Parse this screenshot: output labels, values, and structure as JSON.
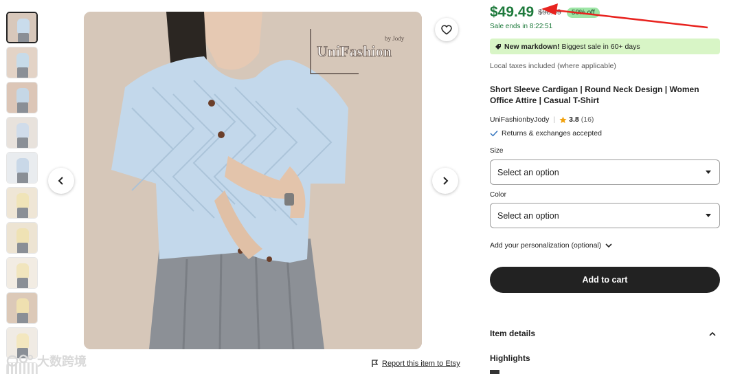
{
  "thumbnails": [
    {
      "bg": "#d8c8bb",
      "top": "#c9dcec",
      "active": true
    },
    {
      "bg": "#e3d3c6",
      "top": "#c7dbe9",
      "active": false
    },
    {
      "bg": "#dcc6b7",
      "top": "#c5d7e6",
      "active": false
    },
    {
      "bg": "#e8e2dc",
      "top": "#d0dcea",
      "active": false
    },
    {
      "bg": "#e9ecef",
      "top": "#c9d8e8",
      "active": false
    },
    {
      "bg": "#efe6d6",
      "top": "#f0e4b8",
      "active": false
    },
    {
      "bg": "#ede4d3",
      "top": "#efe2b4",
      "active": false
    },
    {
      "bg": "#f2ece3",
      "top": "#f1e5bd",
      "active": false
    },
    {
      "bg": "#dcc9b8",
      "top": "#efe0b0",
      "active": false
    },
    {
      "bg": "#f0ebe4",
      "top": "#f3e7bf",
      "active": false
    }
  ],
  "image": {
    "brand_main": "UniFashion",
    "brand_small": "by Jody"
  },
  "report_link": "Report this item to Etsy",
  "watermark_text": "大数跨境",
  "price": {
    "current": "$49.49",
    "original": "$98.99",
    "discount": "50% off",
    "sale_ends": "Sale ends in 8:22:51"
  },
  "markdown": {
    "bold": "New markdown!",
    "rest": "Biggest sale in 60+ days"
  },
  "taxes": "Local taxes included (where applicable)",
  "title": "Short Sleeve Cardigan | Round Neck Design | Women Office Attire | Casual T-Shirt",
  "shop": {
    "name": "UniFashionbyJody",
    "rating": "3.8",
    "reviews": "(16)"
  },
  "returns": "Returns & exchanges accepted",
  "size": {
    "label": "Size",
    "placeholder": "Select an option"
  },
  "color": {
    "label": "Color",
    "placeholder": "Select an option"
  },
  "personalization": "Add your personalization (optional)",
  "cart_button": "Add to cart",
  "item_details": "Item details",
  "highlights": "Highlights",
  "colors": {
    "price_green": "#1e7a3c",
    "discount_bg": "#9ee6a6",
    "markdown_bg": "#d8f5c6",
    "button_dark": "#222222",
    "arrow_red": "#e8231f"
  }
}
